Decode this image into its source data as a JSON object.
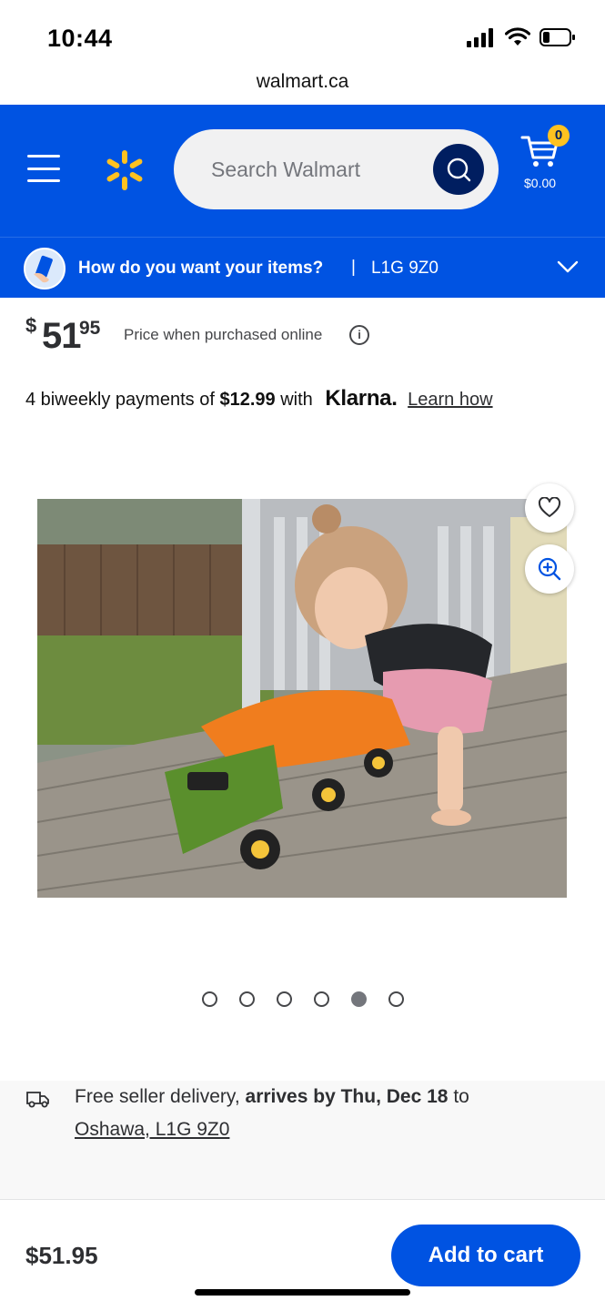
{
  "status_bar": {
    "time": "10:44",
    "icons": [
      "signal-icon",
      "wifi-icon",
      "battery-icon"
    ]
  },
  "browser": {
    "url": "walmart.ca"
  },
  "header": {
    "search_placeholder": "Search Walmart",
    "cart_count": "0",
    "cart_total": "$0.00",
    "colors": {
      "brand_blue": "#0053e2",
      "spark_yellow": "#ffc220",
      "search_button": "#001e60"
    }
  },
  "fulfillment": {
    "question": "How do you want your items?",
    "separator": "|",
    "postal_code": "L1G 9Z0"
  },
  "price": {
    "currency_symbol": "$",
    "whole": "51",
    "cents": "95",
    "note": "Price when purchased online",
    "info_glyph": "i"
  },
  "klarna": {
    "prefix": "4 biweekly payments of",
    "amount": "$12.99",
    "with": "with",
    "brand": "Klarna.",
    "link": "Learn how"
  },
  "gallery": {
    "image_count": 6,
    "active_index": 4
  },
  "delivery": {
    "prefix": "Free seller delivery,",
    "arrival": "arrives by Thu, Dec 18",
    "suffix": "to",
    "location": "Oshawa, L1G 9Z0"
  },
  "bottom_bar": {
    "price": "$51.95",
    "add_to_cart_label": "Add to cart"
  }
}
